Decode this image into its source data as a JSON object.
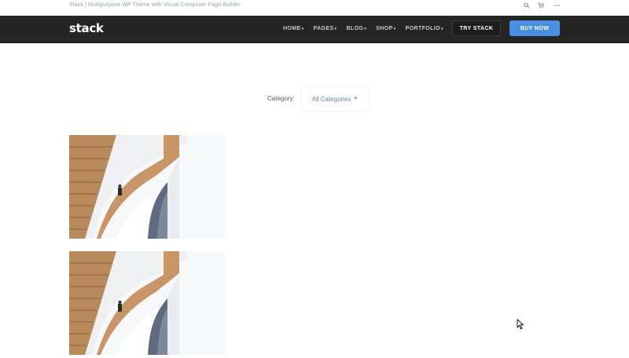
{
  "topbar": {
    "tagline": "Stack | Multipurpose WP Theme with Visual Composer Page Builder",
    "icons": [
      "search-icon",
      "cart-icon",
      "more-icon"
    ]
  },
  "navbar": {
    "logo": "stack",
    "menu": [
      {
        "label": "HOME"
      },
      {
        "label": "PAGES"
      },
      {
        "label": "BLOG"
      },
      {
        "label": "SHOP"
      },
      {
        "label": "PORTFOLIO"
      }
    ],
    "try_label": "TRY STACK",
    "buy_label": "BUY NOW"
  },
  "filter": {
    "label": "Category:",
    "selected": "All Categories"
  },
  "gallery": {
    "items": [
      {
        "image": "staircase-photo"
      },
      {
        "image": "staircase-photo"
      }
    ]
  },
  "colors": {
    "navbar_bg": "#252525",
    "accent": "#4a90e2",
    "select_text": "#6a86b8"
  }
}
